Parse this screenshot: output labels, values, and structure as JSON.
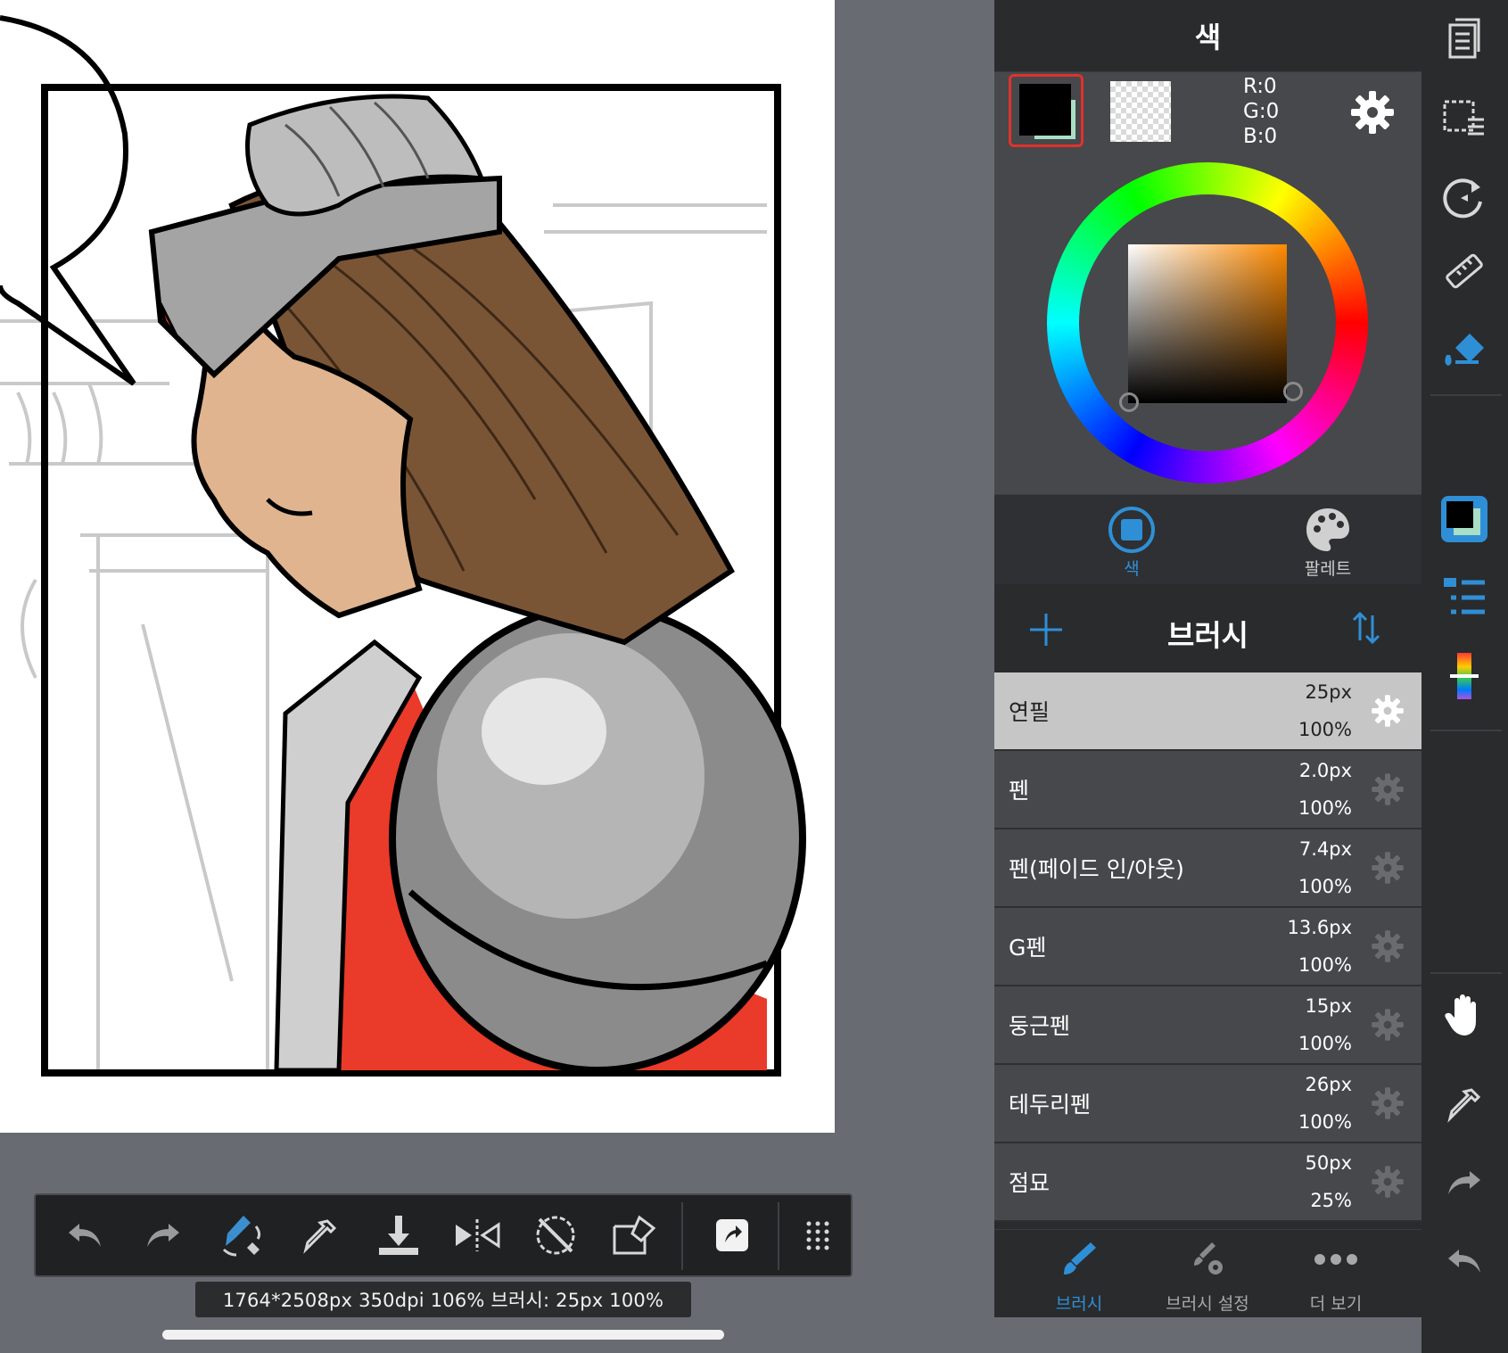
{
  "canvas": {
    "status_text": "1764*2508px 350dpi 106% 브러시: 25px 100%"
  },
  "toolbar": {
    "buttons": [
      "undo-icon",
      "redo-icon",
      "brush-swap-icon",
      "eyedropper-icon",
      "download-icon",
      "flip-icon",
      "rotate-reset-icon",
      "snap-icon",
      "export-icon",
      "grid-menu-icon"
    ]
  },
  "color_panel": {
    "title": "색",
    "rgb": {
      "r": "R:0",
      "g": "G:0",
      "b": "B:0"
    },
    "foreground_color": "#000000",
    "background_color": "#a9dfc4",
    "selected_hue": "#ff8a00",
    "tabs": [
      {
        "label": "색",
        "active": true
      },
      {
        "label": "팔레트",
        "active": false
      }
    ]
  },
  "brush_panel": {
    "title": "브러시",
    "items": [
      {
        "name": "연필",
        "size": "25px",
        "opacity": "100%",
        "active": true
      },
      {
        "name": "펜",
        "size": "2.0px",
        "opacity": "100%",
        "active": false
      },
      {
        "name": "펜(페이드 인/아웃)",
        "size": "7.4px",
        "opacity": "100%",
        "active": false
      },
      {
        "name": "G펜",
        "size": "13.6px",
        "opacity": "100%",
        "active": false
      },
      {
        "name": "둥근펜",
        "size": "15px",
        "opacity": "100%",
        "active": false
      },
      {
        "name": "테두리펜",
        "size": "26px",
        "opacity": "100%",
        "active": false
      },
      {
        "name": "점묘",
        "size": "50px",
        "opacity": "25%",
        "active": false
      }
    ]
  },
  "bottom_tabs": [
    {
      "label": "브러시",
      "active": true
    },
    {
      "label": "브러시 설정",
      "active": false
    },
    {
      "label": "더 보기",
      "active": false
    }
  ],
  "colors": {
    "accent": "#2f8fd6",
    "panel_bg": "#2a2b2d",
    "row_bg": "#47484b",
    "active_row_bg": "#c6c6c6",
    "swatch_border": "#e0322c"
  }
}
